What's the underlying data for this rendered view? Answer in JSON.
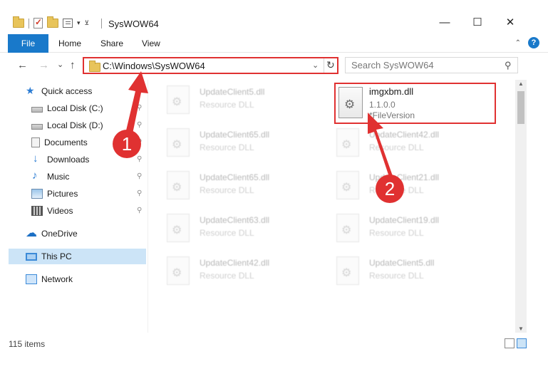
{
  "window": {
    "title": "SysWOW64",
    "minimize": "—",
    "maximize": "☐",
    "close": "✕"
  },
  "ribbon": {
    "file": "File",
    "tabs": [
      "Home",
      "Share",
      "View"
    ],
    "help": "?"
  },
  "address": {
    "path": "C:\\Windows\\SysWOW64",
    "refresh": "↻",
    "dropdown": "⌄"
  },
  "search": {
    "placeholder": "Search SysWOW64"
  },
  "nav": {
    "back": "←",
    "forward": "→",
    "recent": "⌄",
    "up": "↑"
  },
  "sidebar": {
    "items": [
      {
        "label": "Quick access",
        "icon": "star-icon"
      },
      {
        "label": "Local Disk (C:)",
        "icon": "drive-icon",
        "pinned": true
      },
      {
        "label": "Local Disk (D:)",
        "icon": "drive-icon",
        "pinned": true
      },
      {
        "label": "Documents",
        "icon": "documents-icon",
        "pinned": true
      },
      {
        "label": "Downloads",
        "icon": "downloads-icon",
        "pinned": true
      },
      {
        "label": "Music",
        "icon": "music-icon",
        "pinned": true
      },
      {
        "label": "Pictures",
        "icon": "pictures-icon",
        "pinned": true
      },
      {
        "label": "Videos",
        "icon": "videos-icon",
        "pinned": true
      },
      {
        "label": "OneDrive",
        "icon": "cloud-icon"
      },
      {
        "label": "This PC",
        "icon": "computer-icon",
        "selected": true
      },
      {
        "label": "Network",
        "icon": "network-icon"
      }
    ],
    "pin_glyph": "📌"
  },
  "files": {
    "left_column": [
      {
        "name": "UpdateClient5.dll",
        "type": "Resource DLL"
      },
      {
        "name": "UpdateClient65.dll",
        "type": "Resource DLL"
      },
      {
        "name": "UpdateClient65.dll",
        "type": "Resource DLL"
      },
      {
        "name": "UpdateClient63.dll",
        "type": "Resource DLL"
      },
      {
        "name": "UpdateClient42.dll",
        "type": "Resource DLL"
      }
    ],
    "right_column": [
      {
        "name": "UpdateClient42.dll",
        "type": "Resource DLL"
      },
      {
        "name": "UpdateClient21.dll",
        "type": "Resource DLL"
      },
      {
        "name": "UpdateClient19.dll",
        "type": "Resource DLL"
      },
      {
        "name": "UpdateClient5.dll",
        "type": "Resource DLL"
      }
    ],
    "highlighted": {
      "name": "imgxbm.dll",
      "version": "1.1.0.0",
      "description": "*FileVersion"
    }
  },
  "status": {
    "item_count": "115 items"
  },
  "annotations": {
    "step1": "1",
    "step2": "2",
    "color": "#e03131"
  },
  "colors": {
    "accent": "#1979ca",
    "highlight": "#e03131",
    "selected": "#cce4f7"
  }
}
